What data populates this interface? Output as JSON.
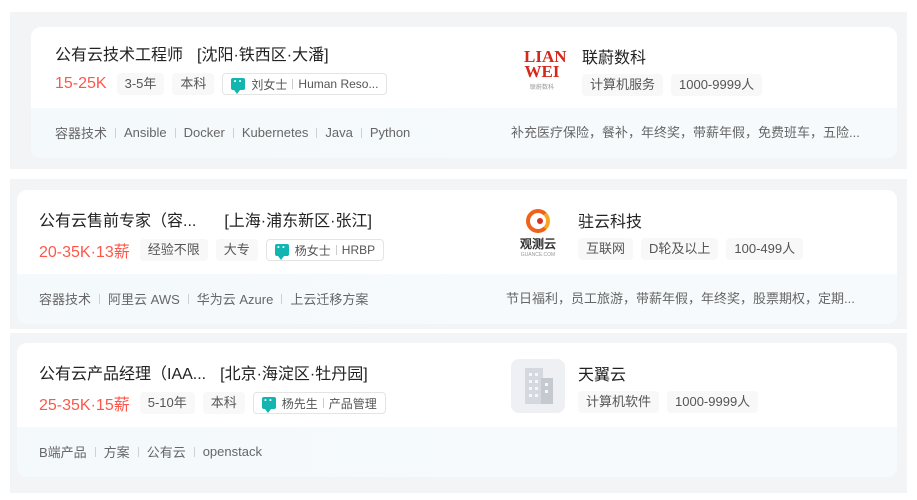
{
  "jobs": [
    {
      "title": "公有云技术工程师",
      "location": "[沈阳·铁西区·大潘]",
      "salary": "15-25K",
      "tags": [
        "3-5年",
        "本科"
      ],
      "recruiter": {
        "name": "刘女士",
        "role": "Human Reso..."
      },
      "skills": [
        "容器技术",
        "Ansible",
        "Docker",
        "Kubernetes",
        "Java",
        "Python"
      ],
      "company": {
        "name": "联蔚数科",
        "logo_text": "LIAN WEI",
        "logo_sub": "联蔚数科",
        "tags": [
          "计算机服务",
          "1000-9999人"
        ]
      },
      "benefits": "补充医疗保险，餐补，年终奖，带薪年假，免费班车，五险..."
    },
    {
      "title": "公有云售前专家（容...",
      "location": "[上海·浦东新区·张江]",
      "salary": "20-35K·13薪",
      "tags": [
        "经验不限",
        "大专"
      ],
      "recruiter": {
        "name": "杨女士",
        "role": "HRBP"
      },
      "skills": [
        "容器技术",
        "阿里云 AWS",
        "华为云 Azure",
        "上云迁移方案"
      ],
      "company": {
        "name": "驻云科技",
        "logo_text": "观测云",
        "logo_sub": "GUANCE.COM",
        "tags": [
          "互联网",
          "D轮及以上",
          "100-499人"
        ]
      },
      "benefits": "节日福利，员工旅游，带薪年假，年终奖，股票期权，定期..."
    },
    {
      "title": "公有云产品经理（IAA...",
      "location": "[北京·海淀区·牡丹园]",
      "salary": "25-35K·15薪",
      "tags": [
        "5-10年",
        "本科"
      ],
      "recruiter": {
        "name": "杨先生",
        "role": "产品管理"
      },
      "skills": [
        "B端产品",
        "方案",
        "公有云",
        "openstack"
      ],
      "company": {
        "name": "天翼云",
        "tags": [
          "计算机软件",
          "1000-9999人"
        ]
      },
      "benefits": ""
    }
  ],
  "colors": {
    "salary": "#fe574a",
    "chat_icon": "#12b5b0",
    "page_band": "#f3f4f6"
  }
}
